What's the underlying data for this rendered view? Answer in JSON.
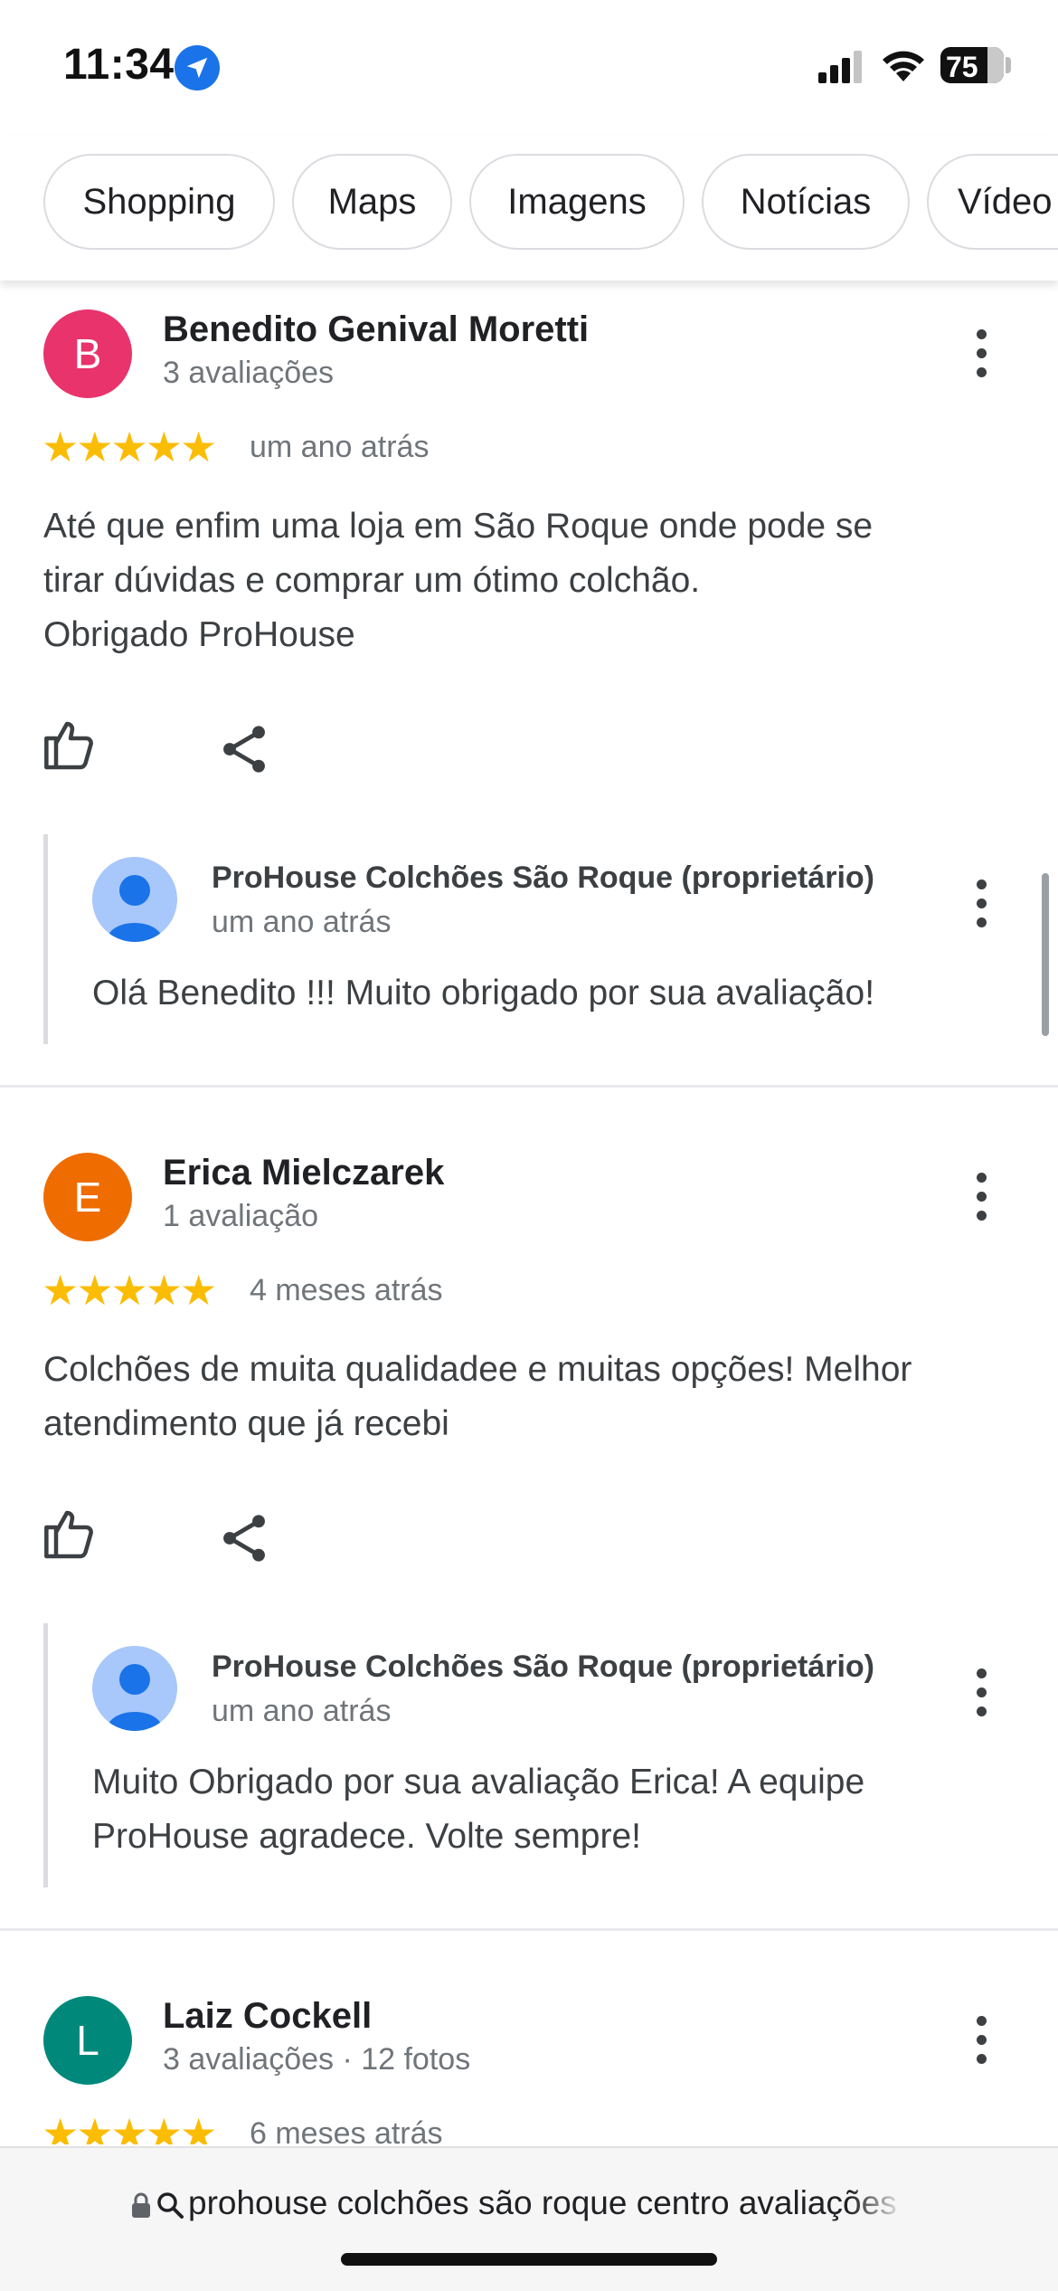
{
  "status_bar": {
    "time": "11:34",
    "battery": "75"
  },
  "chips": [
    {
      "label": "Shopping"
    },
    {
      "label": "Maps"
    },
    {
      "label": "Imagens"
    },
    {
      "label": "Notícias"
    },
    {
      "label": "Vídeo"
    }
  ],
  "reviews": [
    {
      "initial": "B",
      "avatar_color": "#e8336d",
      "name": "Benedito Genival Moretti",
      "meta": "3 avaliações",
      "rating": 5,
      "time": "um ano atrás",
      "text": "Até que enfim uma loja em São Roque onde pode se\ntirar dúvidas e comprar um ótimo colchão.\nObrigado ProHouse",
      "reply": {
        "owner": "ProHouse Colchões São Roque (proprietário)",
        "time": "um ano atrás",
        "text": "Olá Benedito !!! Muito obrigado por sua avaliação!"
      }
    },
    {
      "initial": "E",
      "avatar_color": "#ef6c00",
      "name": "Erica Mielczarek",
      "meta": "1 avaliação",
      "rating": 5,
      "time": "4 meses atrás",
      "text": "Colchões de muita qualidadee e muitas opções! Melhor\natendimento que já recebi",
      "reply": {
        "owner": "ProHouse Colchões São Roque (proprietário)",
        "time": "um ano atrás",
        "text": "Muito Obrigado por sua avaliação Erica! A equipe\nProHouse agradece. Volte sempre!"
      }
    },
    {
      "initial": "L",
      "avatar_color": "#00897b",
      "name": "Laiz Cockell",
      "meta": "3 avaliações · 12 fotos",
      "rating": 5,
      "time": "6 meses atrás"
    }
  ],
  "url_bar": {
    "query": "prohouse colchões são roque centro avaliações"
  },
  "colors": {
    "star": "#fbbc04",
    "accent": "#1a73e8"
  }
}
